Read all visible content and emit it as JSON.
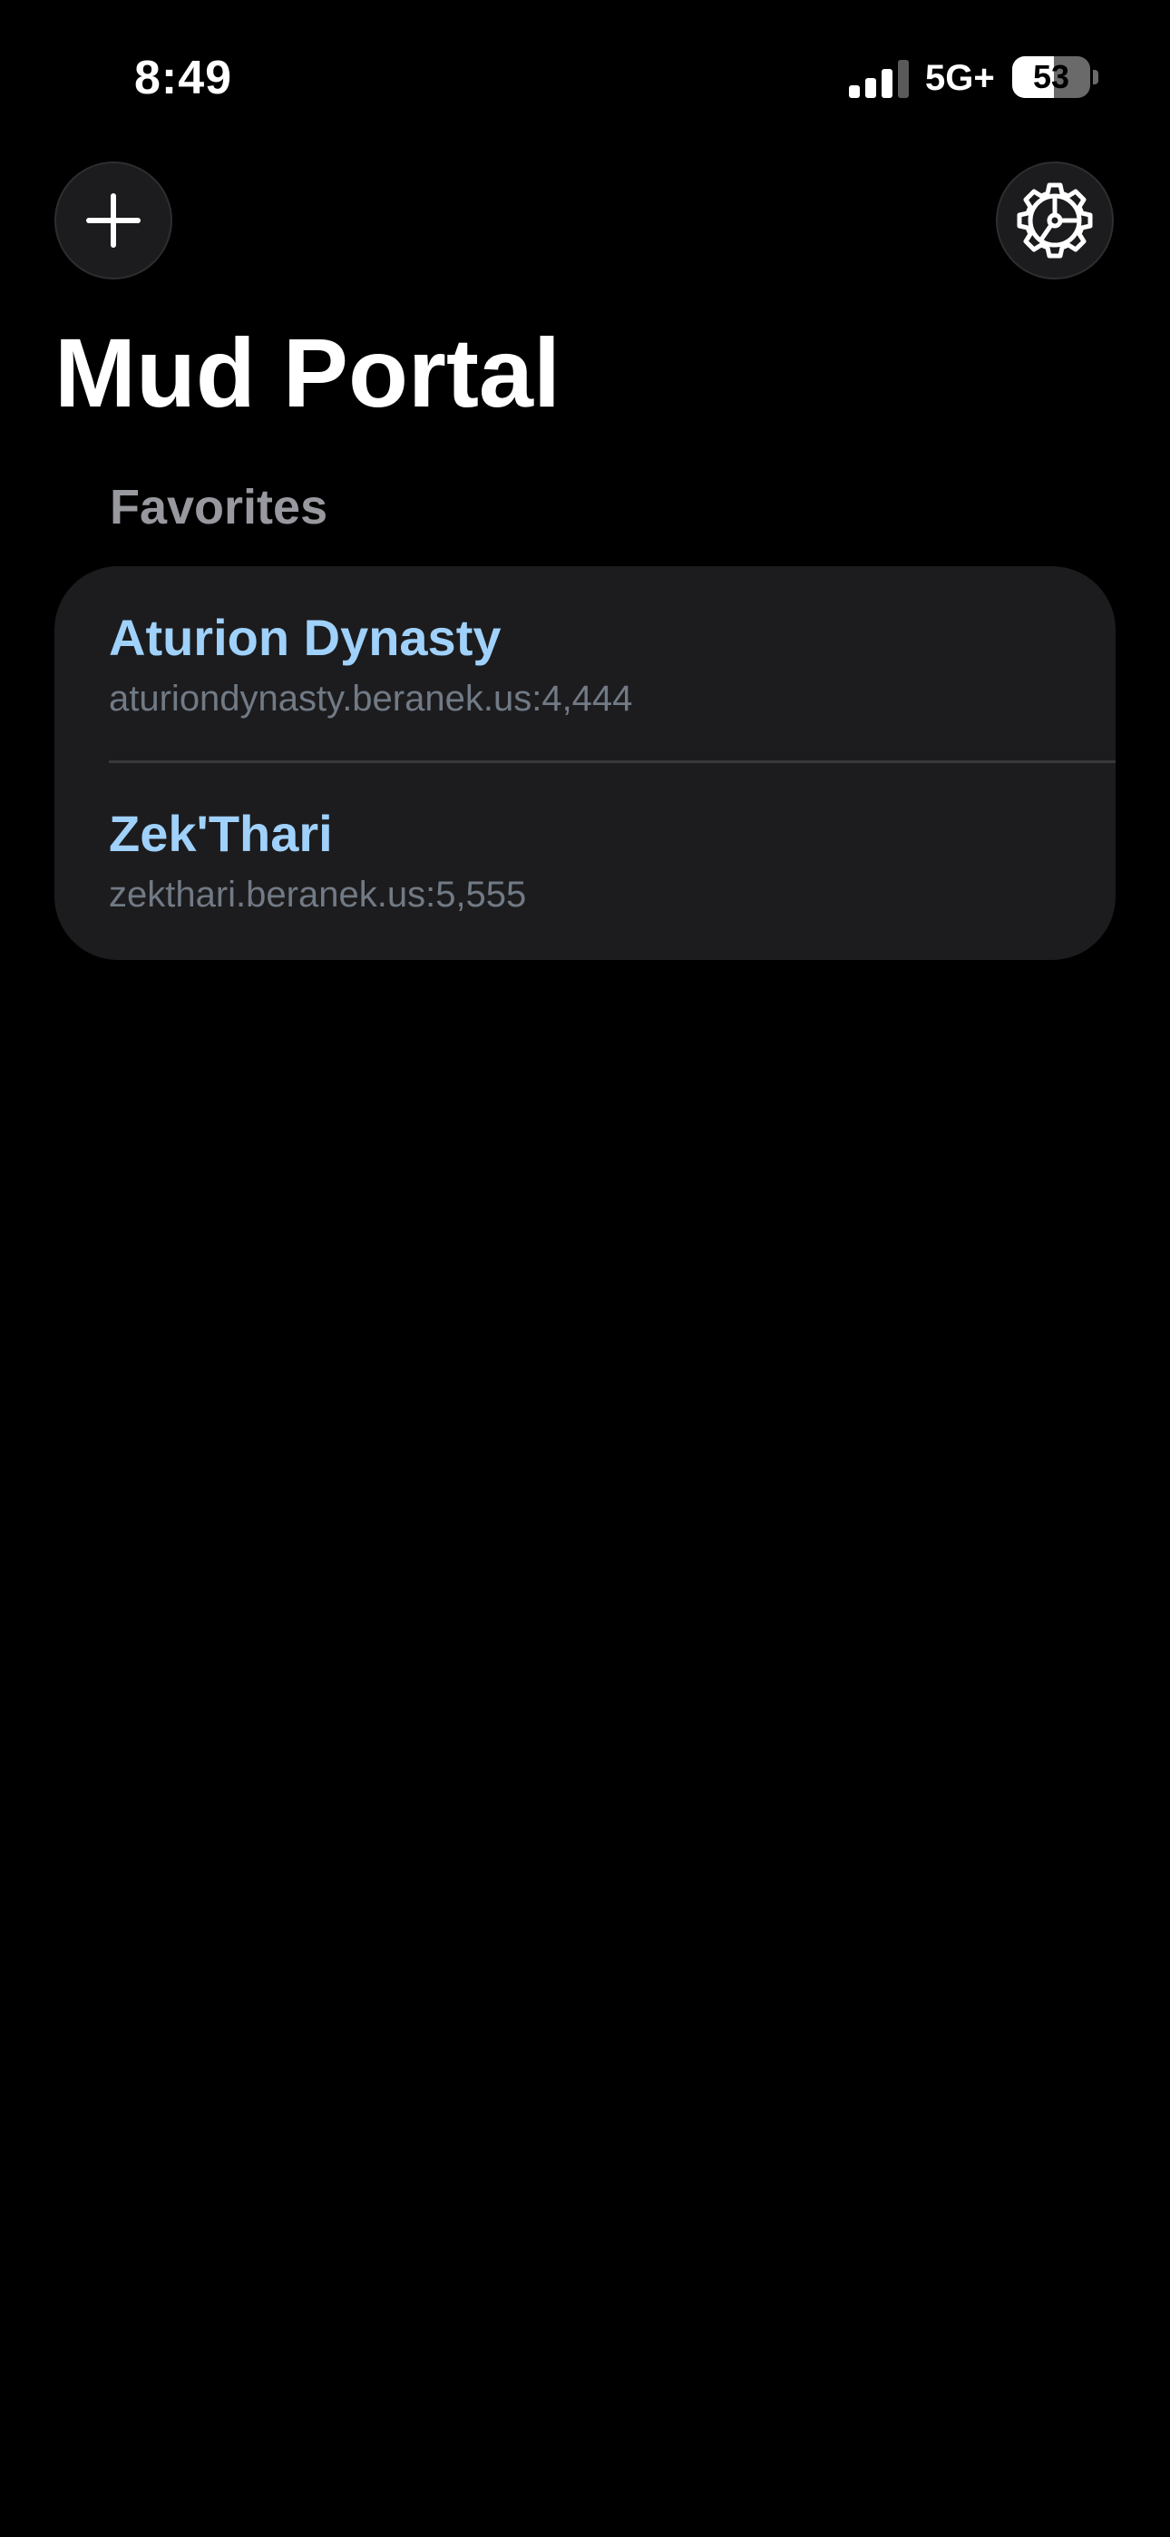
{
  "status_bar": {
    "time": "8:49",
    "signal_icon": "cellular-signal-icon",
    "signal_bars": 3,
    "signal_bars_total": 4,
    "network": "5G+",
    "battery_level": "53",
    "battery_fraction": 0.53
  },
  "toolbar": {
    "add_icon": "plus-icon",
    "settings_icon": "gear-icon"
  },
  "page": {
    "title": "Mud Portal"
  },
  "favorites": {
    "header": "Favorites",
    "items": [
      {
        "name": "Aturion Dynasty",
        "address": "aturiondynasty.beranek.us:4,444"
      },
      {
        "name": "Zek'Thari",
        "address": "zekthari.beranek.us:5,555"
      }
    ]
  },
  "colors": {
    "background": "#000000",
    "card": "#1c1c1e",
    "accent_title": "#9fd1fb",
    "secondary_text": "#717a85",
    "section_header": "#98989f"
  }
}
